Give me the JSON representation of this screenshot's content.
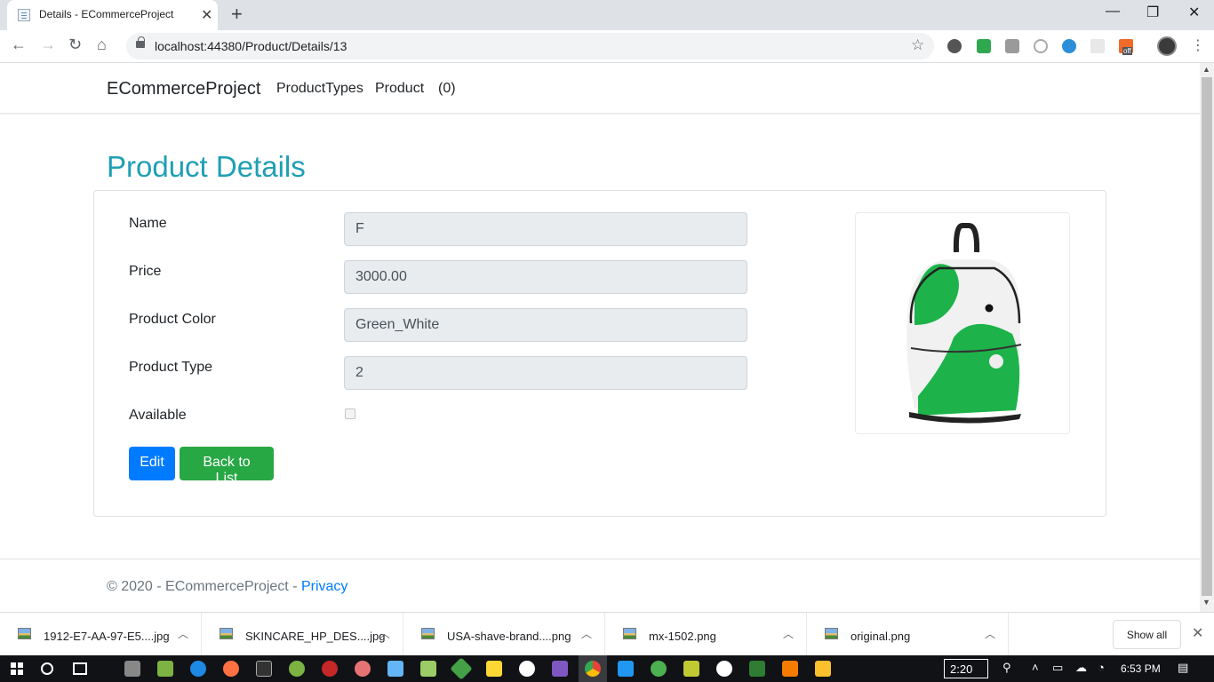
{
  "browser": {
    "tab_title": "Details - ECommerceProject",
    "url": "localhost:44380/Product/Details/13",
    "new_tab": "+",
    "close_tab": "✕",
    "minimize": "—",
    "restore": "❐",
    "close_window": "✕",
    "ext_badge": "off"
  },
  "navbar": {
    "brand": "ECommerceProject",
    "links": [
      "ProductTypes",
      "Product",
      "(0)"
    ]
  },
  "page": {
    "heading": "Product Details",
    "fields": [
      {
        "label": "Name",
        "value": "F"
      },
      {
        "label": "Price",
        "value": "3000.00"
      },
      {
        "label": "Product Color",
        "value": "Green_White"
      },
      {
        "label": "Product Type",
        "value": "2"
      }
    ],
    "available_label": "Available",
    "available_checked": false,
    "edit_label": "Edit",
    "back_label": "Back to List",
    "image_colors": {
      "green": "#1db34a",
      "white": "#f4f4f4",
      "dark": "#111111"
    }
  },
  "footer": {
    "text": "© 2020 - ECommerceProject - ",
    "privacy": "Privacy"
  },
  "downloads": {
    "items": [
      "1912-E7-AA-97-E5....jpg",
      "SKINCARE_HP_DES....jpg",
      "USA-shave-brand....png",
      "mx-1502.png",
      "original.png"
    ],
    "show_all": "Show all"
  },
  "taskbar": {
    "time_box": "2:20",
    "clock": "6:53 PM"
  },
  "colors": {
    "heading": "#1e9fb4",
    "edit_button": "#007bff",
    "back_button": "#28a745",
    "link": "#007bff"
  }
}
